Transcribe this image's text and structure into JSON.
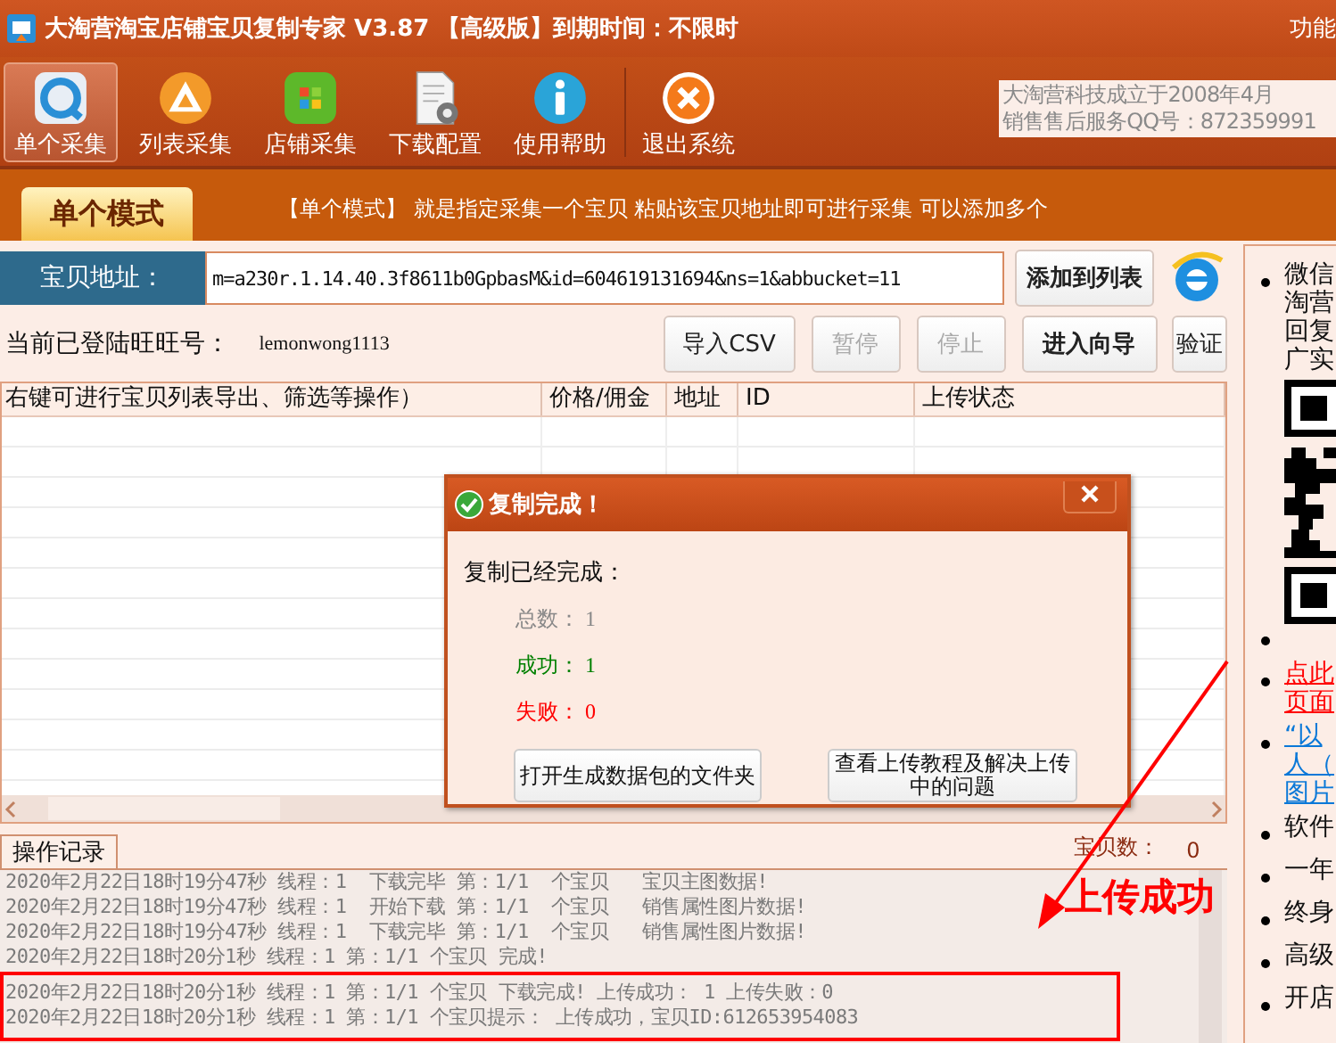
{
  "window": {
    "title": "大淘营淘宝店铺宝贝复制专家 V3.87 【高级版】到期时间：不限时",
    "menu": "功能"
  },
  "toolbar": {
    "buttons": [
      {
        "label": "单个采集",
        "selected": true
      },
      {
        "label": "列表采集",
        "selected": false
      },
      {
        "label": "店铺采集",
        "selected": false
      },
      {
        "label": "下载配置",
        "selected": false
      },
      {
        "label": "使用帮助",
        "selected": false
      },
      {
        "label": "退出系统",
        "selected": false
      }
    ],
    "info_lines": [
      "大淘营科技成立于2008年4月",
      "销售售后服务QQ号：872359991"
    ]
  },
  "mode": {
    "tab": "单个模式",
    "description": "【单个模式】 就是指定采集一个宝贝 粘贴该宝贝地址即可进行采集 可以添加多个"
  },
  "address": {
    "label": "宝贝地址：",
    "value": "m=a230r.1.14.40.3f8611b0GpbasM&id=604619131694&ns=1&abbucket=11",
    "add_button": "添加到列表"
  },
  "account": {
    "label": "当前已登陆旺旺号：",
    "value": "lemonwong1113",
    "buttons": [
      {
        "label": "导入CSV",
        "disabled": false,
        "bold": false
      },
      {
        "label": "暂停",
        "disabled": true,
        "bold": false
      },
      {
        "label": "停止",
        "disabled": true,
        "bold": false
      },
      {
        "label": "进入向导",
        "disabled": false,
        "bold": true
      },
      {
        "label": "验证",
        "disabled": false,
        "bold": false
      }
    ]
  },
  "table": {
    "columns": [
      "右键可进行宝贝列表导出、筛选等操作）",
      "价格/佣金",
      "地址",
      "ID",
      "上传状态"
    ]
  },
  "dialog": {
    "title": "复制完成！",
    "message": "复制已经完成：",
    "stats": [
      {
        "label": "总数：",
        "value": "1",
        "color": "#888888"
      },
      {
        "label": "成功：",
        "value": "1",
        "color": "#008000"
      },
      {
        "label": "失败：",
        "value": "0",
        "color": "#ff0000"
      }
    ],
    "buttons": [
      "打开生成数据包的文件夹",
      "查看上传教程及解决上传中的问题"
    ]
  },
  "log": {
    "tab": "操作记录",
    "count_label": "宝贝数：",
    "count": "0",
    "lines": [
      "2020年2月22日18时19分47秒 线程：1  下载完毕 第：1/1  个宝贝   宝贝主图数据!",
      "2020年2月22日18时19分47秒 线程：1  开始下载 第：1/1  个宝贝   销售属性图片数据!",
      "2020年2月22日18时19分47秒 线程：1  下载完毕 第：1/1  个宝贝   销售属性图片数据!",
      "2020年2月22日18时20分1秒 线程：1 第：1/1 个宝贝 完成!",
      "2020年2月22日18时20分1秒 线程：1 第：1/1 个宝贝 下载完成! 上传成功： 1 上传失败：0",
      "2020年2月22日18时20分1秒 线程：1 第：1/1 个宝贝提示： 上传成功，宝贝ID:612653954083"
    ]
  },
  "sidebar": {
    "items": [
      {
        "kind": "text",
        "lines": [
          "微信",
          "淘营",
          "回复",
          "广实"
        ]
      },
      {
        "kind": "qr"
      },
      {
        "kind": "empty"
      },
      {
        "kind": "link",
        "color": "#ff0000",
        "lines": [
          "点此",
          "页面"
        ]
      },
      {
        "kind": "link",
        "color": "#0a78d8",
        "lines": [
          "“以",
          "人（",
          "图片"
        ]
      },
      {
        "kind": "text",
        "lines": [
          "软件"
        ]
      },
      {
        "kind": "text",
        "lines": [
          "一年"
        ]
      },
      {
        "kind": "text",
        "lines": [
          "终身"
        ]
      },
      {
        "kind": "text",
        "lines": [
          "高级"
        ]
      },
      {
        "kind": "text",
        "lines": [
          "开店"
        ]
      }
    ]
  },
  "annotation": {
    "label": "上传成功"
  }
}
